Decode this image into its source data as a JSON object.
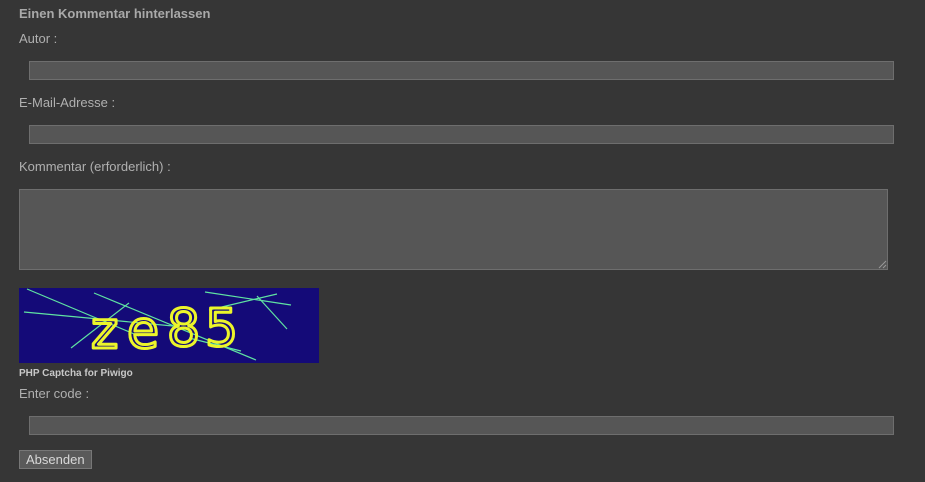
{
  "comment_form": {
    "heading": "Einen Kommentar hinterlassen",
    "author_label": "Autor :",
    "author_value": "",
    "email_label": "E-Mail-Adresse :",
    "email_value": "",
    "comment_label": "Kommentar (erforderlich) :",
    "comment_value": "",
    "captcha": {
      "characters": [
        "z",
        "e",
        "8",
        "5"
      ],
      "credit": "PHP Captcha for Piwigo",
      "background_color": "#140a78",
      "text_color": "#ecf52a",
      "line_color": "#5fe3a2"
    },
    "code_label": "Enter code :",
    "code_value": "",
    "submit_label": "Absenden"
  }
}
